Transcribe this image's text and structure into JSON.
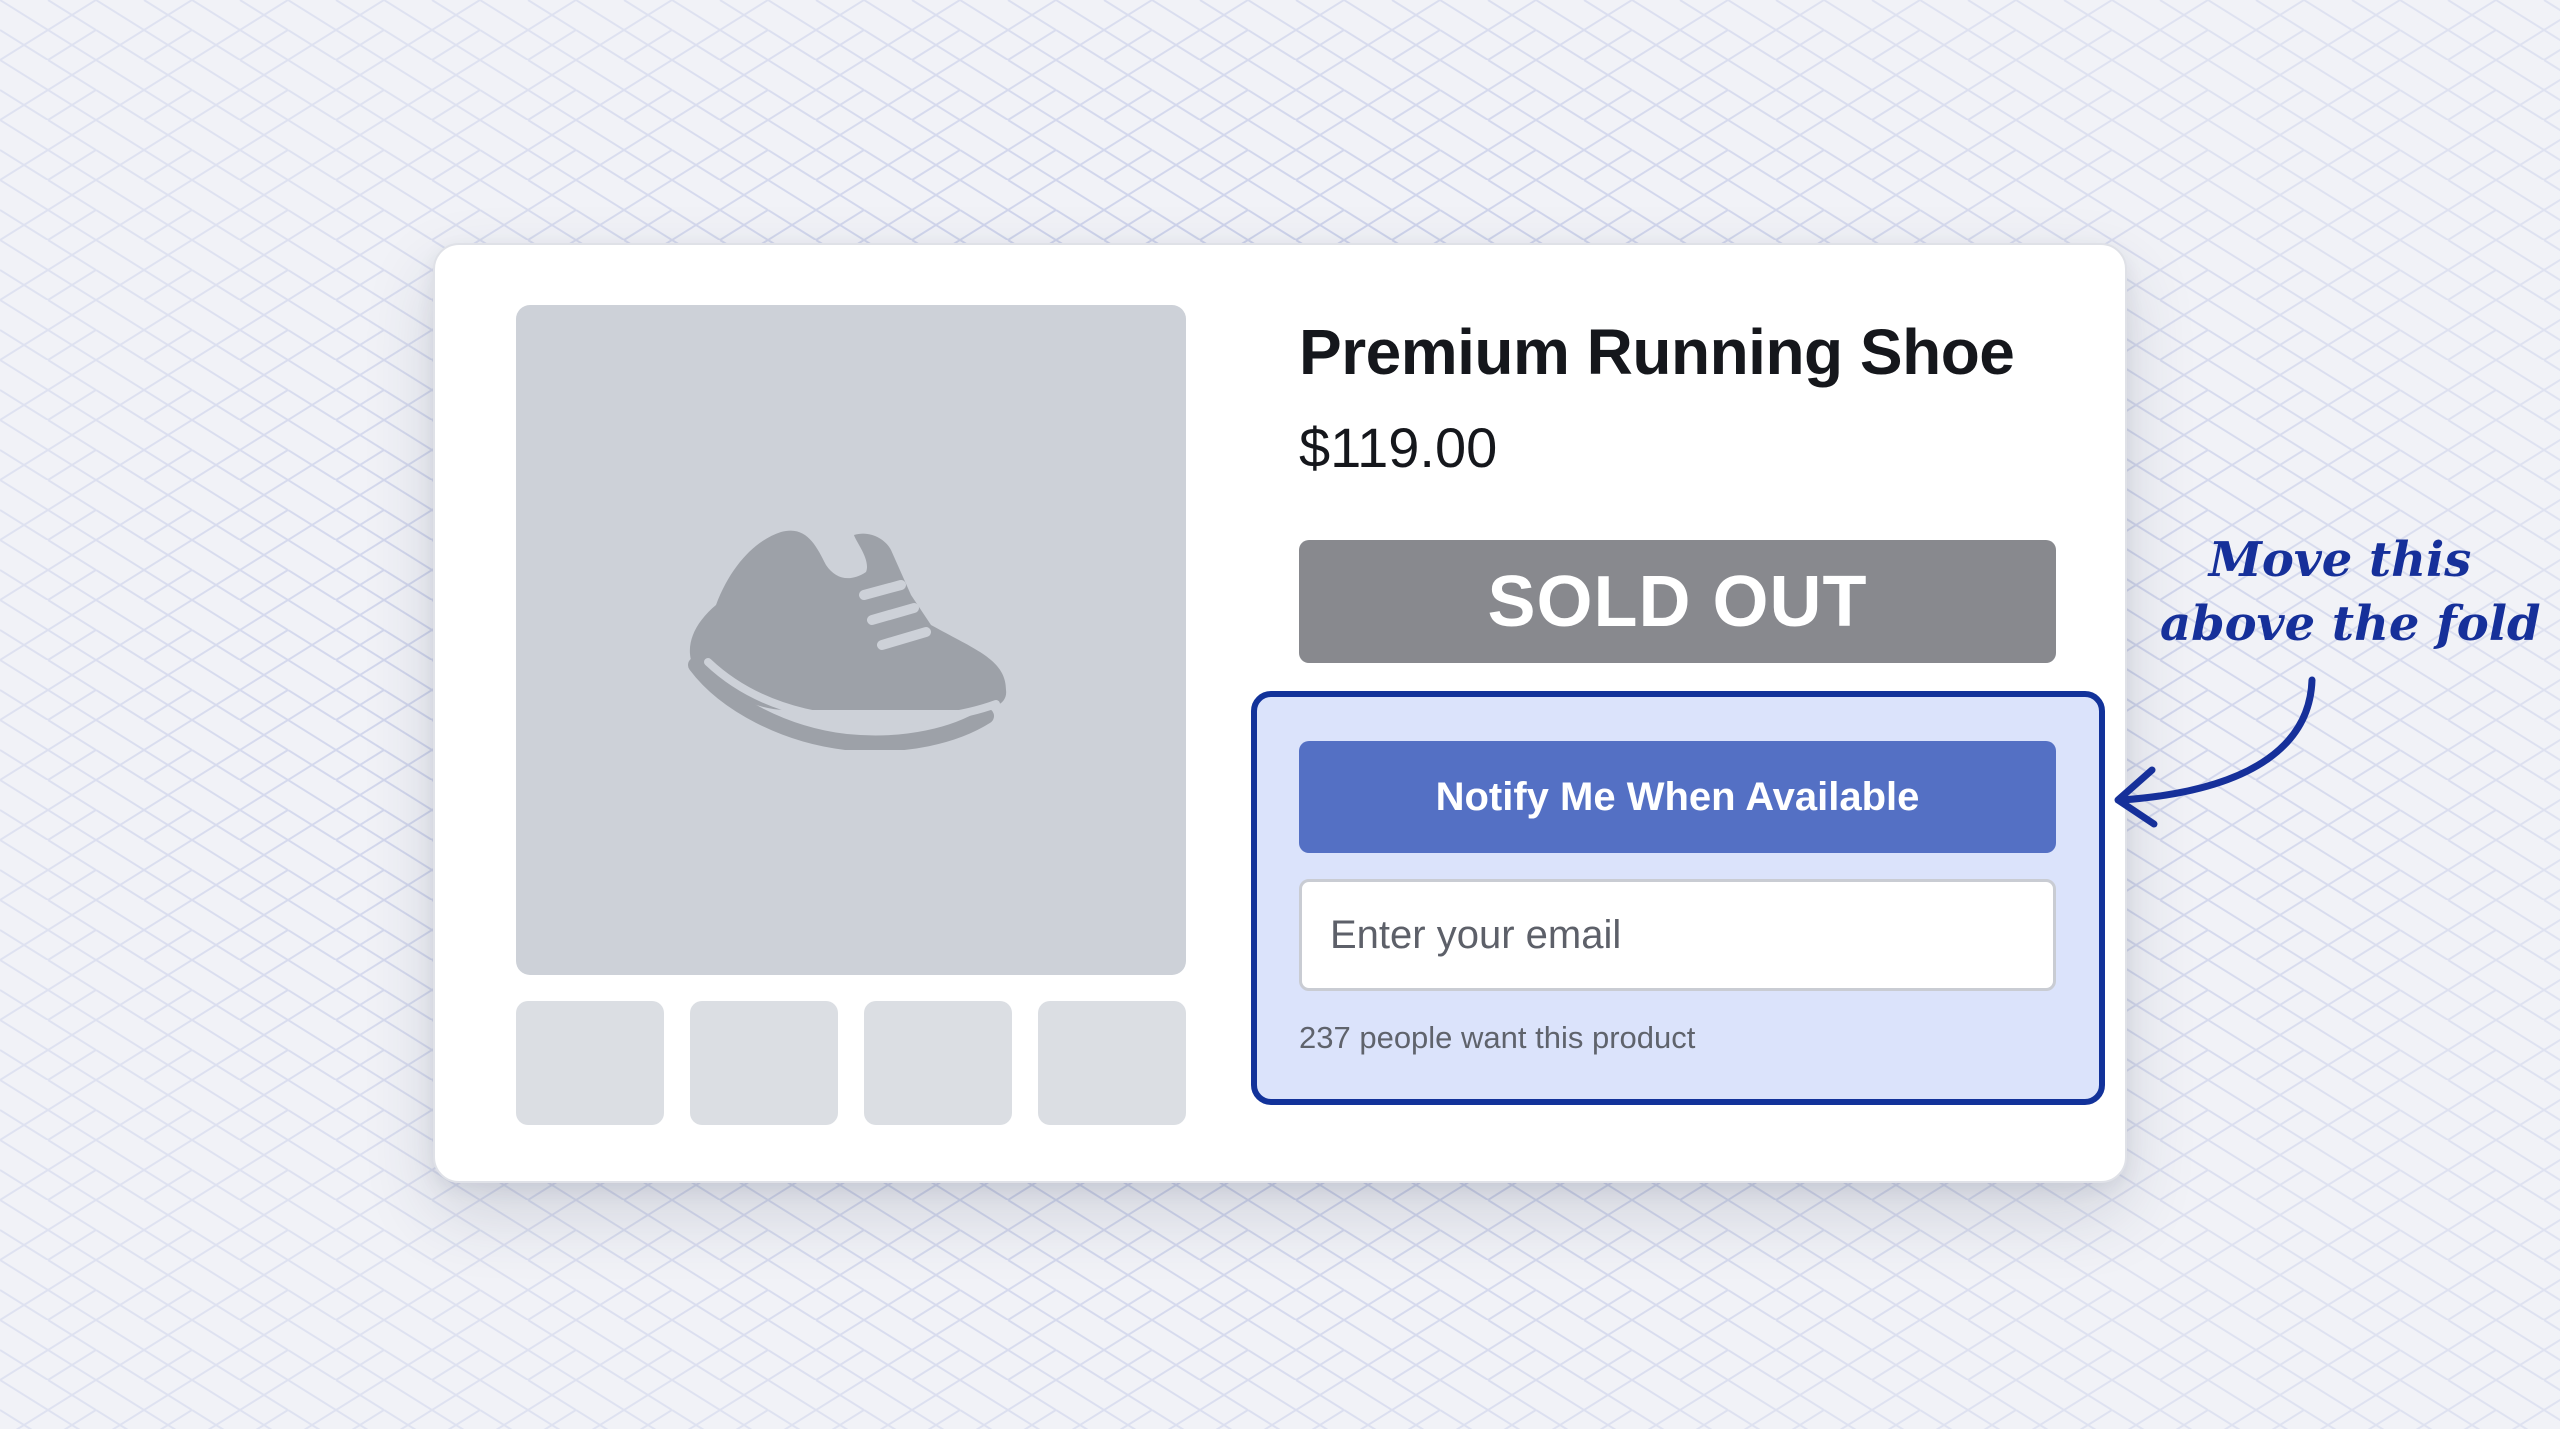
{
  "product": {
    "title": "Premium Running Shoe",
    "price": "$119.00",
    "status_label": "SOLD OUT",
    "main_image_icon": "sneaker-icon",
    "thumbnail_count": 4
  },
  "notify": {
    "button_label": "Notify Me When Available",
    "email_placeholder": "Enter your email",
    "email_value": "",
    "demand_text": "237 people want this product"
  },
  "annotation": {
    "line1": "Move this",
    "line2": "above the fold",
    "arrow_icon": "curved-arrow-left-icon"
  },
  "colors": {
    "sold_out_bg": "#88898e",
    "notify_button_bg": "#5470c4",
    "highlight_border": "#12329a",
    "highlight_fill": "#dbe3fb",
    "annotation_ink": "#16309a"
  }
}
